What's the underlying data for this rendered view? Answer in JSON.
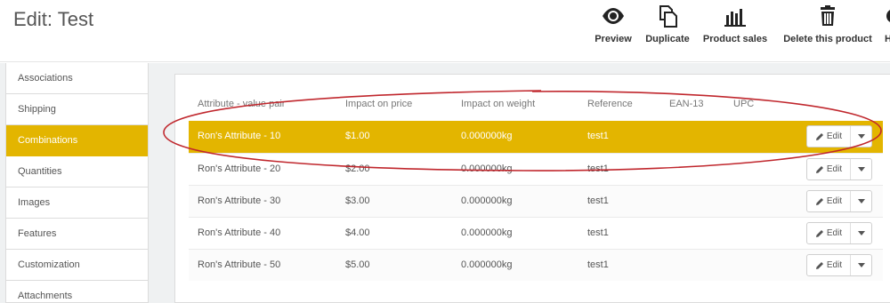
{
  "header": {
    "title": "Edit: Test"
  },
  "toolbar": {
    "preview": {
      "label": "Preview",
      "icon": "eye-icon"
    },
    "duplicate": {
      "label": "Duplicate",
      "icon": "copy-icon"
    },
    "product_sales": {
      "label": "Product sales",
      "icon": "bar-chart-icon"
    },
    "delete": {
      "label": "Delete this product",
      "icon": "trash-icon"
    }
  },
  "sidebar": {
    "items": [
      {
        "label": "Associations"
      },
      {
        "label": "Shipping"
      },
      {
        "label": "Combinations",
        "active": true
      },
      {
        "label": "Quantities"
      },
      {
        "label": "Images"
      },
      {
        "label": "Features"
      },
      {
        "label": "Customization"
      },
      {
        "label": "Attachments"
      }
    ]
  },
  "table": {
    "headers": {
      "attribute": "Attribute - value pair",
      "impact_price": "Impact on price",
      "impact_weight": "Impact on weight",
      "reference": "Reference",
      "ean13": "EAN-13",
      "upc": "UPC"
    },
    "rows": [
      {
        "attribute": "Ron's Attribute - 10",
        "price": "$1.00",
        "weight": "0.000000kg",
        "reference": "test1",
        "edit": "Edit",
        "highlighted": true
      },
      {
        "attribute": "Ron's Attribute - 20",
        "price": "$2.00",
        "weight": "0.000000kg",
        "reference": "test1",
        "edit": "Edit"
      },
      {
        "attribute": "Ron's Attribute - 30",
        "price": "$3.00",
        "weight": "0.000000kg",
        "reference": "test1",
        "edit": "Edit"
      },
      {
        "attribute": "Ron's Attribute - 40",
        "price": "$4.00",
        "weight": "0.000000kg",
        "reference": "test1",
        "edit": "Edit"
      },
      {
        "attribute": "Ron's Attribute - 50",
        "price": "$5.00",
        "weight": "0.000000kg",
        "reference": "test1",
        "edit": "Edit"
      }
    ]
  },
  "colors": {
    "accent": "#e3b500",
    "annotation": "#c0272d"
  }
}
